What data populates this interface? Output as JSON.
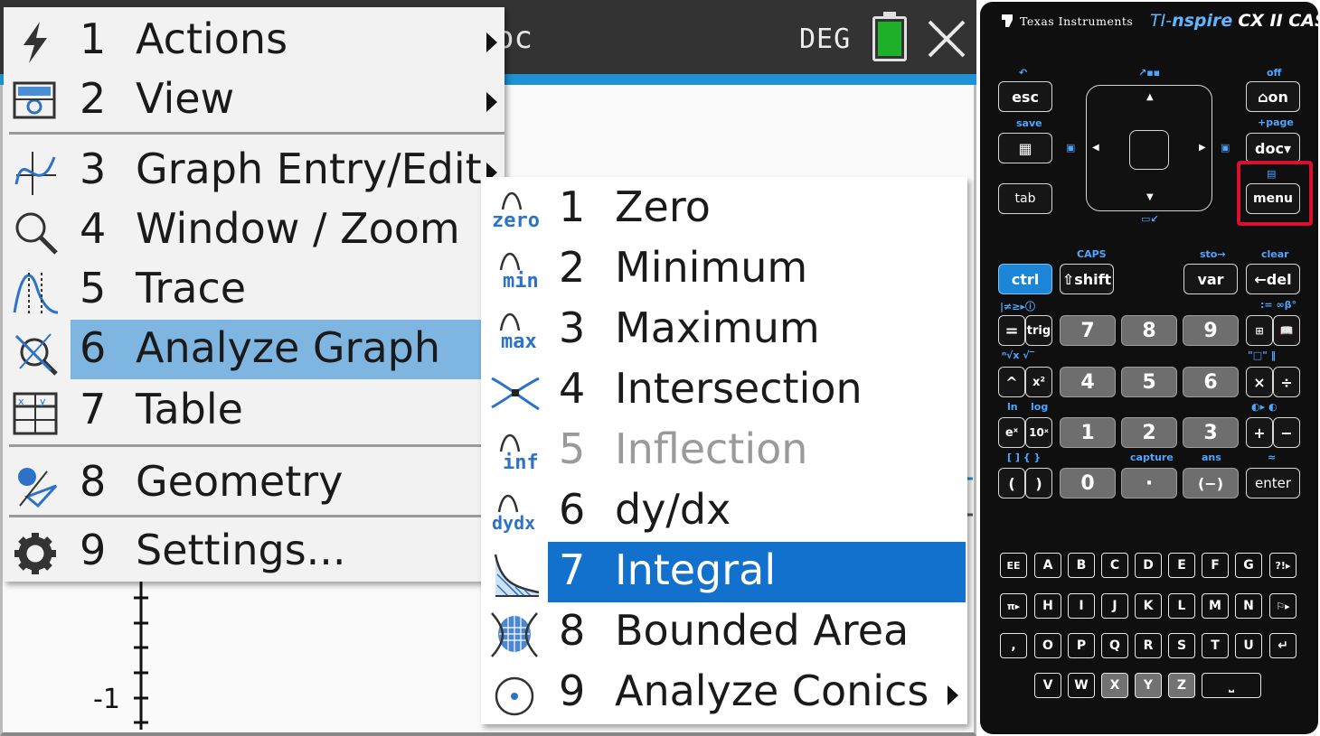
{
  "screen": {
    "title_fragment": "oc",
    "angle_mode": "DEG",
    "axis_tick_label": "-1",
    "colors": {
      "titlebar": "#333333",
      "accent": "#1e92d4",
      "battery": "#1fb02a"
    }
  },
  "main_menu": {
    "items": [
      {
        "num": "1",
        "label": "Actions",
        "icon": "bolt-icon",
        "submenu": true
      },
      {
        "num": "2",
        "label": "View",
        "icon": "view-icon",
        "submenu": true
      },
      {
        "num": "3",
        "label": "Graph Entry/Edit",
        "icon": "graph-entry-icon",
        "submenu": true
      },
      {
        "num": "4",
        "label": "Window / Zoom",
        "icon": "magnifier-icon",
        "submenu": false
      },
      {
        "num": "5",
        "label": "Trace",
        "icon": "trace-icon",
        "submenu": false
      },
      {
        "num": "6",
        "label": "Analyze Graph",
        "icon": "analyze-graph-icon",
        "submenu": false,
        "highlighted": true
      },
      {
        "num": "7",
        "label": "Table",
        "icon": "table-icon",
        "submenu": false
      },
      {
        "num": "8",
        "label": "Geometry",
        "icon": "geometry-icon",
        "submenu": false
      },
      {
        "num": "9",
        "label": "Settings...",
        "icon": "gear-icon",
        "submenu": false
      }
    ]
  },
  "sub_menu": {
    "items": [
      {
        "num": "1",
        "label": "Zero",
        "icon_text": "zero"
      },
      {
        "num": "2",
        "label": "Minimum",
        "icon_text": "min"
      },
      {
        "num": "3",
        "label": "Maximum",
        "icon_text": "max"
      },
      {
        "num": "4",
        "label": "Intersection",
        "icon_text": ""
      },
      {
        "num": "5",
        "label": "Inflection",
        "icon_text": "inf",
        "disabled": true
      },
      {
        "num": "6",
        "label": "dy/dx",
        "icon_text": "dydx"
      },
      {
        "num": "7",
        "label": "Integral",
        "icon_text": "",
        "highlighted": true
      },
      {
        "num": "8",
        "label": "Bounded Area",
        "icon_text": ""
      },
      {
        "num": "9",
        "label": "Analyze Conics",
        "icon_text": "",
        "submenu": true
      }
    ],
    "highlight_color": "#1271cc"
  },
  "calculator": {
    "brand": "Texas Instruments",
    "model_prefix": "TI-",
    "model_name": "nspire",
    "model_suffix": "CX II CAS",
    "keys": {
      "esc": "esc",
      "on": "on",
      "doc": "doc",
      "menu": "menu",
      "tab": "tab",
      "ctrl": "ctrl",
      "shift": "shift",
      "var": "var",
      "del": "del",
      "eq": "=",
      "trig": "trig",
      "n7": "7",
      "n8": "8",
      "n9": "9",
      "caret": "^",
      "x2": "x²",
      "n4": "4",
      "n5": "5",
      "n6": "6",
      "mul": "×",
      "div": "÷",
      "ex": "eˣ",
      "tenx": "10ˣ",
      "n1": "1",
      "n2": "2",
      "n3": "3",
      "plus": "+",
      "minus": "−",
      "lparen": "(",
      "rparen": ")",
      "n0": "0",
      "dot": "·",
      "neg": "(−)",
      "enter": "enter",
      "ee": "EE"
    },
    "small_labels": {
      "save": "save",
      "off": "off",
      "page": "+page",
      "caps": "CAPS",
      "sto": "sto→",
      "clear": "clear",
      "ln": "ln",
      "log": "log",
      "capture": "capture",
      "ans": "ans",
      "approx": "≈"
    },
    "letters_row1": [
      "A",
      "B",
      "C",
      "D",
      "E",
      "F",
      "G"
    ],
    "letters_row2": [
      "H",
      "I",
      "J",
      "K",
      "L",
      "M",
      "N"
    ],
    "letters_row3": [
      "O",
      "P",
      "Q",
      "R",
      "S",
      "T",
      "U"
    ],
    "letters_row4": [
      "V",
      "W",
      "X",
      "Y",
      "Z"
    ],
    "highlight_key": "menu",
    "highlight_color": "#d8102e"
  }
}
